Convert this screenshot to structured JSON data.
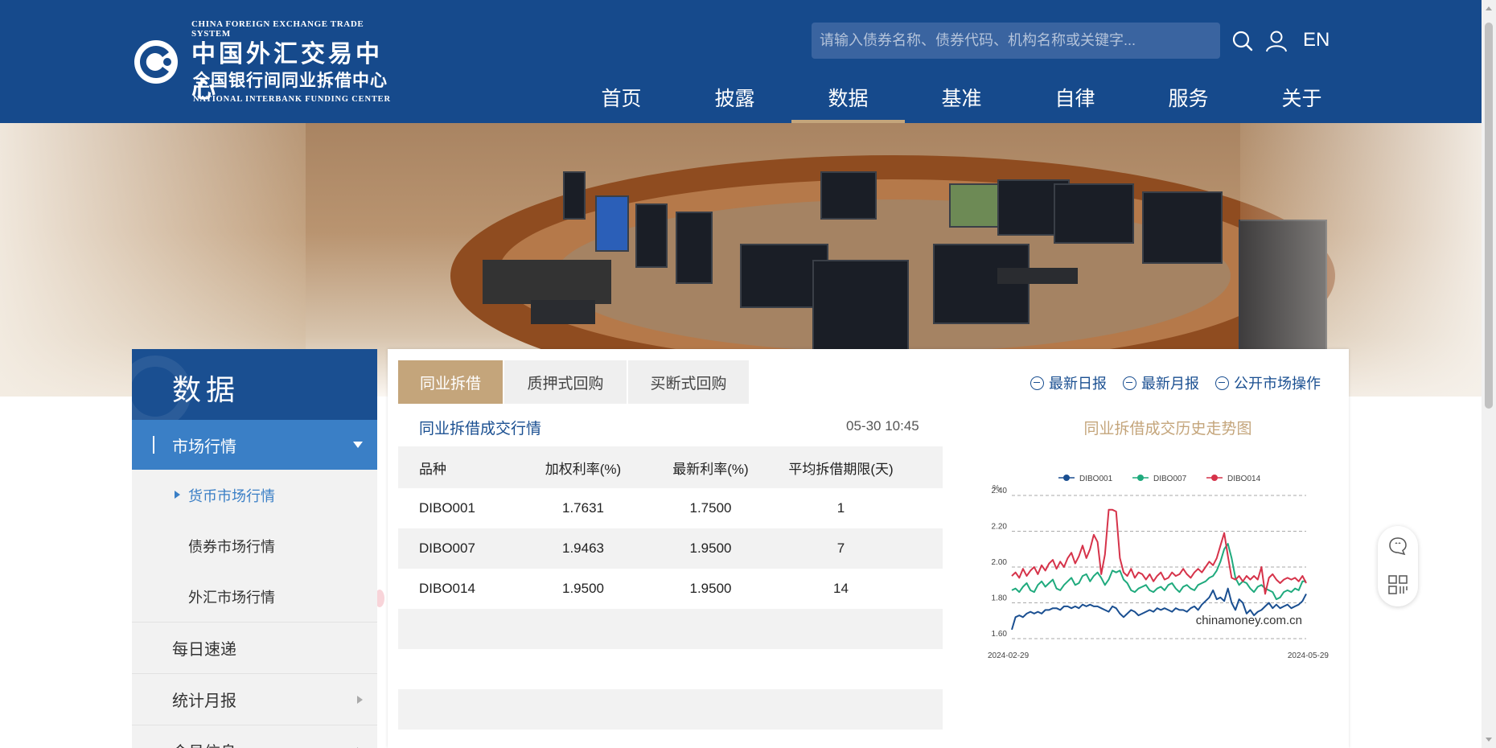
{
  "header": {
    "logo_en_top": "CHINA FOREIGN EXCHANGE TRADE SYSTEM",
    "logo_cn_main": "中国外汇交易中心",
    "logo_cn_sub": "全国银行间同业拆借中心",
    "logo_en_bottom": "NATIONAL INTERBANK FUNDING CENTER",
    "search_placeholder": "请输入债券名称、债券代码、机构名称或关键字...",
    "lang_label": "EN",
    "nav": [
      {
        "label": "首页",
        "active": false
      },
      {
        "label": "披露",
        "active": false
      },
      {
        "label": "数据",
        "active": true
      },
      {
        "label": "基准",
        "active": false
      },
      {
        "label": "自律",
        "active": false
      },
      {
        "label": "服务",
        "active": false
      },
      {
        "label": "关于",
        "active": false
      }
    ]
  },
  "sidebar": {
    "title": "数据",
    "active_section": "市场行情",
    "sub_items": [
      {
        "label": "货币市场行情",
        "active": true
      },
      {
        "label": "债券市场行情",
        "active": false
      },
      {
        "label": "外汇市场行情",
        "active": false
      }
    ],
    "items": [
      {
        "label": "每日速递",
        "has_arrow": false
      },
      {
        "label": "统计月报",
        "has_arrow": true
      },
      {
        "label": "会员信息",
        "has_arrow": true
      }
    ]
  },
  "main": {
    "tabs": [
      {
        "label": "同业拆借",
        "active": true
      },
      {
        "label": "质押式回购",
        "active": false
      },
      {
        "label": "买断式回购",
        "active": false
      }
    ],
    "quick_links": [
      "最新日报",
      "最新月报",
      "公开市场操作"
    ],
    "table": {
      "title": "同业拆借成交行情",
      "time": "05-30 10:45",
      "columns": [
        "品种",
        "加权利率(%)",
        "最新利率(%)",
        "平均拆借期限(天)"
      ],
      "rows": [
        [
          "DIBO001",
          "1.7631",
          "1.7500",
          "1"
        ],
        [
          "DIBO007",
          "1.9463",
          "1.9500",
          "7"
        ],
        [
          "DIBO014",
          "1.9500",
          "1.9500",
          "14"
        ]
      ]
    }
  },
  "chart_data": {
    "type": "line",
    "title": "同业拆借成交历史走势图",
    "ylabel": "%",
    "ylim": [
      1.6,
      2.4
    ],
    "yticks": [
      "2.40",
      "2.20",
      "2.00",
      "1.80",
      "1.60"
    ],
    "x_start_label": "2024-02-29",
    "x_end_label": "2024-05-29",
    "watermark": "chinamoney.com.cn",
    "legend_position": "top",
    "grid": "dashed-horizontal",
    "series": [
      {
        "name": "DIBO001",
        "color": "#1a4f91",
        "values": [
          1.65,
          1.72,
          1.73,
          1.72,
          1.74,
          1.75,
          1.74,
          1.75,
          1.74,
          1.76,
          1.76,
          1.77,
          1.77,
          1.76,
          1.78,
          1.78,
          1.77,
          1.78,
          1.77,
          1.79,
          1.78,
          1.79,
          1.78,
          1.78,
          1.77,
          1.76,
          1.75,
          1.78,
          1.77,
          1.74,
          1.72,
          1.74,
          1.76,
          1.75,
          1.73,
          1.74,
          1.75,
          1.76,
          1.75,
          1.77,
          1.76,
          1.77,
          1.76,
          1.75,
          1.77,
          1.76,
          1.76,
          1.75,
          1.77,
          1.78,
          1.76,
          1.79,
          1.81,
          1.83,
          1.87,
          1.82,
          1.83,
          1.81,
          1.88,
          1.8,
          1.76,
          1.82,
          1.8,
          1.74,
          1.76,
          1.73,
          1.75,
          1.76,
          1.78,
          1.8,
          1.77,
          1.79,
          1.77,
          1.78,
          1.79,
          1.77,
          1.78,
          1.79,
          1.81,
          1.85
        ]
      },
      {
        "name": "DIBO007",
        "color": "#1faa7d",
        "values": [
          1.87,
          1.88,
          1.86,
          1.89,
          1.91,
          1.87,
          1.86,
          1.9,
          1.92,
          1.89,
          1.91,
          1.93,
          1.88,
          1.87,
          1.9,
          1.92,
          1.94,
          1.9,
          1.91,
          1.95,
          1.96,
          1.92,
          1.95,
          1.97,
          1.94,
          1.9,
          1.93,
          1.98,
          1.97,
          1.98,
          1.93,
          1.91,
          1.87,
          1.86,
          1.88,
          1.89,
          1.9,
          1.87,
          1.86,
          1.88,
          1.89,
          1.87,
          1.9,
          1.91,
          1.88,
          1.86,
          1.89,
          1.9,
          1.88,
          1.87,
          1.9,
          1.91,
          1.92,
          1.94,
          1.95,
          1.98,
          2.03,
          2.1,
          2.13,
          2.05,
          1.94,
          1.9,
          1.92,
          1.91,
          1.88,
          1.86,
          1.89,
          1.9,
          1.88,
          1.87,
          1.86,
          1.82,
          1.83,
          1.86,
          1.87,
          1.86,
          1.88,
          1.87,
          1.92,
          1.92
        ]
      },
      {
        "name": "DIBO014",
        "color": "#d6334a",
        "values": [
          1.95,
          1.97,
          1.94,
          1.99,
          1.95,
          1.98,
          2.0,
          1.96,
          2.01,
          1.98,
          2.02,
          2.04,
          1.99,
          2.03,
          2.0,
          2.05,
          2.08,
          2.02,
          2.06,
          2.12,
          2.05,
          2.1,
          2.18,
          2.14,
          1.96,
          2.07,
          2.32,
          2.32,
          2.31,
          2.05,
          1.97,
          1.95,
          1.99,
          1.94,
          1.97,
          1.96,
          1.93,
          1.96,
          1.92,
          1.95,
          1.97,
          1.93,
          1.94,
          1.97,
          1.95,
          1.96,
          1.99,
          1.96,
          1.94,
          1.97,
          1.99,
          1.97,
          2.0,
          2.03,
          2.01,
          2.05,
          2.12,
          2.19,
          2.06,
          1.94,
          1.93,
          1.95,
          1.92,
          1.95,
          1.93,
          1.95,
          1.93,
          2.0,
          1.85,
          1.94,
          1.96,
          1.93,
          1.91,
          1.93,
          1.94,
          1.93,
          1.94,
          1.92,
          1.95,
          1.91
        ]
      }
    ]
  }
}
